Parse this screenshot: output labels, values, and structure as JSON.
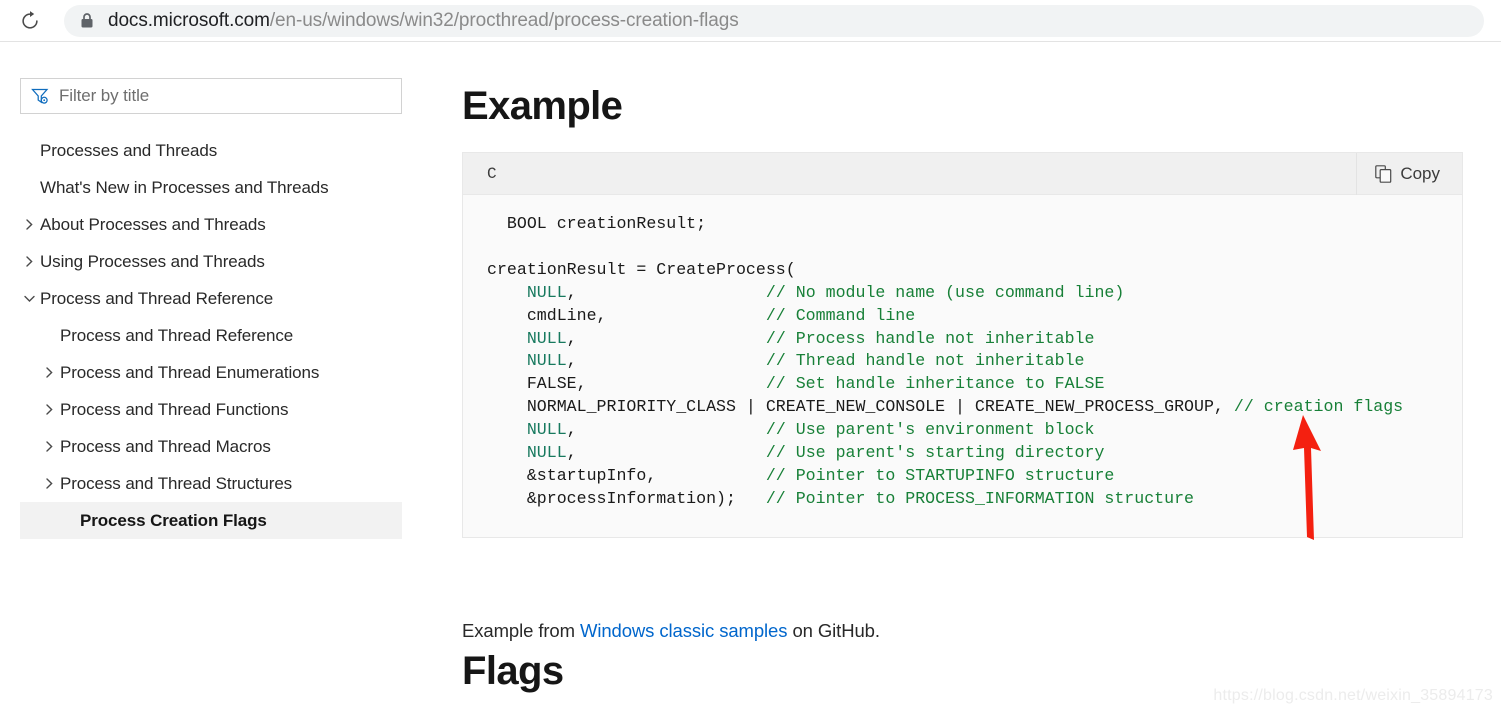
{
  "browser": {
    "reload_icon": "reload-icon",
    "lock_icon": "lock-icon",
    "url_host": "docs.microsoft.com",
    "url_path": "/en-us/windows/win32/procthread/process-creation-flags"
  },
  "sidebar": {
    "filter": {
      "icon": "filter-funnel-icon",
      "placeholder": "Filter by title",
      "value": ""
    },
    "items": [
      {
        "label": "Processes and Threads",
        "level": 0,
        "expandable": false,
        "expanded": false,
        "selected": false
      },
      {
        "label": "What's New in Processes and Threads",
        "level": 0,
        "expandable": false,
        "expanded": false,
        "selected": false
      },
      {
        "label": "About Processes and Threads",
        "level": 0,
        "expandable": true,
        "expanded": false,
        "selected": false
      },
      {
        "label": "Using Processes and Threads",
        "level": 0,
        "expandable": true,
        "expanded": false,
        "selected": false
      },
      {
        "label": "Process and Thread Reference",
        "level": 0,
        "expandable": true,
        "expanded": true,
        "selected": false
      },
      {
        "label": "Process and Thread Reference",
        "level": 1,
        "expandable": false,
        "expanded": false,
        "selected": false
      },
      {
        "label": "Process and Thread Enumerations",
        "level": 1,
        "expandable": true,
        "expanded": false,
        "selected": false
      },
      {
        "label": "Process and Thread Functions",
        "level": 1,
        "expandable": true,
        "expanded": false,
        "selected": false
      },
      {
        "label": "Process and Thread Macros",
        "level": 1,
        "expandable": true,
        "expanded": false,
        "selected": false
      },
      {
        "label": "Process and Thread Structures",
        "level": 1,
        "expandable": true,
        "expanded": false,
        "selected": false
      },
      {
        "label": "Process Creation Flags",
        "level": 1,
        "expandable": false,
        "expanded": false,
        "selected": true
      }
    ]
  },
  "main": {
    "heading_example": "Example",
    "heading_flags": "Flags",
    "code_block": {
      "language_label": "C",
      "copy_label": "Copy",
      "copy_icon": "copy-icon",
      "lines": [
        {
          "text": "  BOOL creationResult;",
          "code": "  BOOL creationResult;",
          "comment": ""
        },
        {
          "text": "",
          "code": "",
          "comment": ""
        },
        {
          "text": "creationResult = CreateProcess(",
          "code": "creationResult = CreateProcess(",
          "comment": ""
        },
        {
          "text": "    NULL,                   // No module name (use command line)",
          "code": "    NULL,",
          "comment": "// No module name (use command line)"
        },
        {
          "text": "    cmdLine,                // Command line",
          "code": "    cmdLine,",
          "comment": "// Command line"
        },
        {
          "text": "    NULL,                   // Process handle not inheritable",
          "code": "    NULL,",
          "comment": "// Process handle not inheritable"
        },
        {
          "text": "    NULL,                   // Thread handle not inheritable",
          "code": "    NULL,",
          "comment": "// Thread handle not inheritable"
        },
        {
          "text": "    FALSE,                  // Set handle inheritance to FALSE",
          "code": "    FALSE,",
          "comment": "// Set handle inheritance to FALSE"
        },
        {
          "text": "    NORMAL_PRIORITY_CLASS | CREATE_NEW_CONSOLE | CREATE_NEW_PROCESS_GROUP, // creation flags",
          "code": "    NORMAL_PRIORITY_CLASS | CREATE_NEW_CONSOLE | CREATE_NEW_PROCESS_GROUP,",
          "comment": "// creation flags"
        },
        {
          "text": "    NULL,                   // Use parent's environment block",
          "code": "    NULL,",
          "comment": "// Use parent's environment block"
        },
        {
          "text": "    NULL,                   // Use parent's starting directory",
          "code": "    NULL,",
          "comment": "// Use parent's starting directory"
        },
        {
          "text": "    &startupInfo,           // Pointer to STARTUPINFO structure",
          "code": "    &startupInfo,",
          "comment": "// Pointer to STARTUPINFO structure"
        },
        {
          "text": "    &processInformation);   // Pointer to PROCESS_INFORMATION structure",
          "code": "    &processInformation);",
          "comment": "// Pointer to PROCESS_INFORMATION structure"
        }
      ]
    },
    "caption": {
      "prefix": "Example from ",
      "link_text": "Windows classic samples",
      "suffix": " on GitHub."
    }
  },
  "annotation": {
    "arrow_color": "#f42010",
    "arrow_name": "red-up-arrow-annotation"
  },
  "watermark": "https://blog.csdn.net/weixin_35894173",
  "colors": {
    "link": "#0066cc",
    "comment_green": "#188038",
    "null_teal": "#17795e",
    "selected_nav_bg": "#f2f2f2",
    "code_header_bg": "#f0f0f0",
    "code_body_bg": "#fafafa",
    "url_pill_bg": "#f1f3f4"
  }
}
